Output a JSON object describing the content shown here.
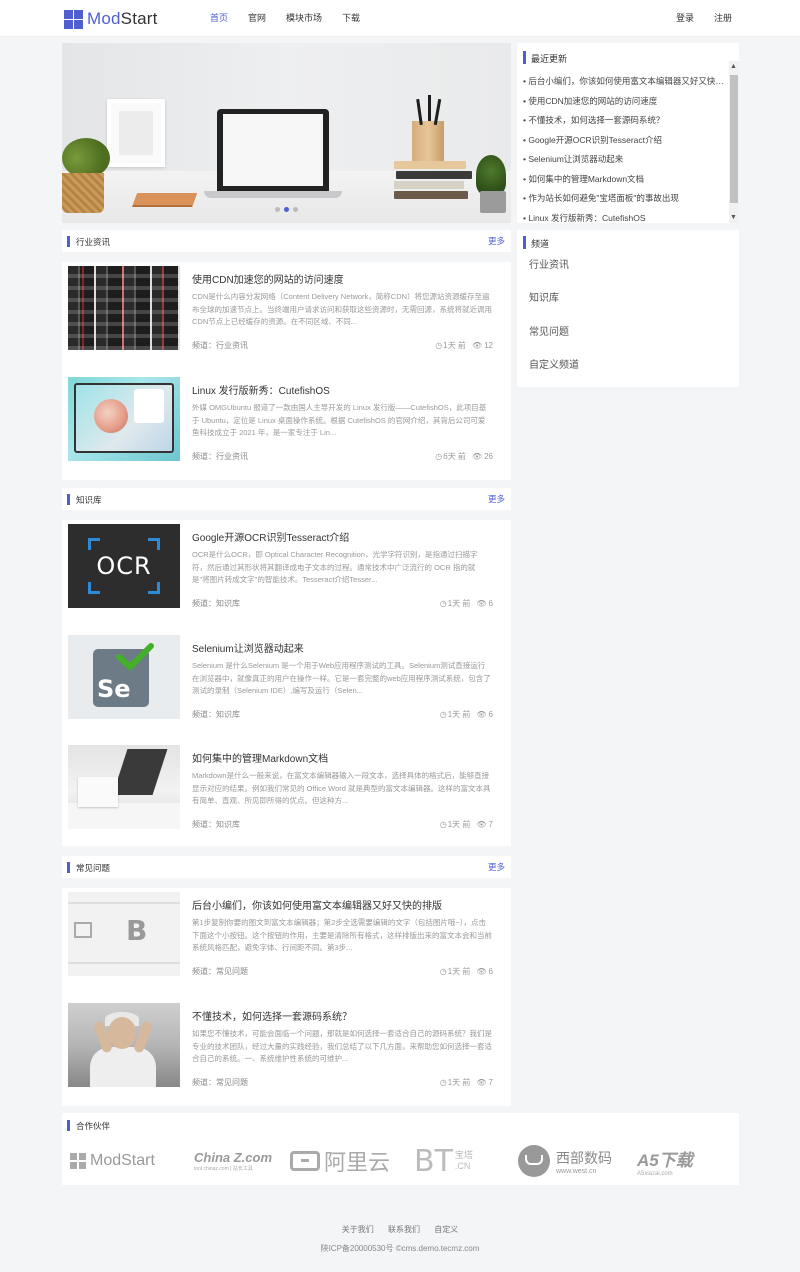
{
  "brand": {
    "logo_a": "Mod",
    "logo_b": "Start"
  },
  "nav": {
    "items": [
      {
        "label": "首页",
        "active": true
      },
      {
        "label": "官网",
        "active": false
      },
      {
        "label": "模块市场",
        "active": false
      },
      {
        "label": "下载",
        "active": false
      }
    ],
    "login": "登录",
    "register": "注册"
  },
  "banner": {
    "slide_index": 2,
    "slide_count": 3
  },
  "latest": {
    "title": "最近更新",
    "items": [
      "后台小编们，你该如何使用富文本编辑器又好又快的排版",
      "使用CDN加速您的网站的访问速度",
      "不懂技术，如何选择一套源码系统？",
      "Google开源OCR识别Tesseract介绍",
      "Selenium让浏览器动起来",
      "如何集中的管理Markdown文档",
      "作为站长如何避免\"宝塔面板\"的事故出现",
      "Linux 发行版新秀：CutefishOS"
    ]
  },
  "channel": {
    "title": "频道",
    "items": [
      "行业资讯",
      "知识库",
      "常见问题",
      "自定义频道"
    ]
  },
  "sections": [
    {
      "title": "行业资讯",
      "more": "更多",
      "articles": [
        {
          "title": "使用CDN加速您的网站的访问速度",
          "desc": "CDN是什么内容分发网络（Content Delivery Network，简称CDN）将您源站资源缓存至遍布全球的加速节点上。当终端用户请求访问和获取这些资源时，无需回源，系统将就近调用CDN节点上已经缓存的资源。在不同区域、不同...",
          "channel": "频道：行业资讯",
          "time": "1天 前",
          "views": "12"
        },
        {
          "title": "Linux 发行版新秀：CutefishOS",
          "desc": "外媒 OMGUbuntu 报道了一款由国人主导开发的 Linux 发行版——CutefishOS，此项目基于 Ubuntu，定位是 Linux 桌面操作系统。根据 CutefishOS 的官网介绍，其背后公司可爱鱼科技成立于 2021 年，是一家专注于 Lin...",
          "channel": "频道：行业资讯",
          "time": "6天 前",
          "views": "26"
        }
      ]
    },
    {
      "title": "知识库",
      "more": "更多",
      "articles": [
        {
          "title": "Google开源OCR识别Tesseract介绍",
          "desc": "OCR是什么OCR，即 Optical Character Recognition，光学字符识别，是指通过扫描字符，然后通过其形状将其翻译成电子文本的过程。通常技术中广泛流行的 OCR 指的就是\"将图片转成文字\"的智能技术。Tesseract介绍Tesser...",
          "channel": "频道：知识库",
          "time": "1天 前",
          "views": "6"
        },
        {
          "title": "Selenium让浏览器动起来",
          "desc": "Selenium 是什么Selenium 是一个用于Web应用程序测试的工具。Selenium测试直接运行在浏览器中，就像真正的用户在操作一样。它是一套完整的web应用程序测试系统，包含了测试的录制（Selenium IDE）,编写及运行（Selen...",
          "channel": "频道：知识库",
          "time": "1天 前",
          "views": "6"
        },
        {
          "title": "如何集中的管理Markdown文档",
          "desc": "Markdown是什么一般来说，在富文本编辑器输入一段文本，选择具体的格式后，能够直接显示对应的结果。例如我们常见的 Office Word 就是典型的富文本编辑器。这样的富文本具有简单、直观、所见即所得的优点。但这种方...",
          "channel": "频道：知识库",
          "time": "1天 前",
          "views": "7"
        }
      ]
    },
    {
      "title": "常见问题",
      "more": "更多",
      "articles": [
        {
          "title": "后台小编们，你该如何使用富文本编辑器又好又快的排版",
          "desc": "第1步复制你要的图文到富文本编辑器；第2步全选需要编辑的文字（包括图片哦~），点击下面这个小按钮。这个按钮的作用，主要是清除所有格式，这样排版出来的富文本会和当前系统风格匹配，避免字体、行间距不同。第3步...",
          "channel": "频道：常见问题",
          "time": "1天 前",
          "views": "6"
        },
        {
          "title": "不懂技术，如何选择一套源码系统？",
          "desc": "如果您不懂技术，可能会面临一个问题，那就是如何选择一套适合自己的源码系统？我们是专业的技术团队，经过大量的实践经验，我们总结了以下几方面，来帮助您如何选择一套适合自己的系统。一、系统维护性系统的可维护...",
          "channel": "频道：常见问题",
          "time": "1天 前",
          "views": "7"
        }
      ]
    }
  ],
  "partners": {
    "title": "合作伙伴",
    "logos": [
      {
        "name": "ModStart",
        "text": "ModStart"
      },
      {
        "name": "China Z",
        "text": "China Z.com",
        "sub": "tool.chinaz.com | 站长工具"
      },
      {
        "name": "阿里云",
        "text": "阿里云"
      },
      {
        "name": "BT宝塔",
        "text": "BT",
        "sub": "宝塔 .CN"
      },
      {
        "name": "西部数码",
        "text": "西部数码",
        "sub": "www.west.cn"
      },
      {
        "name": "A5下载",
        "text": "A5下载",
        "sub": "A5xiazai.com"
      }
    ]
  },
  "footer": {
    "links": [
      "关于我们",
      "联系我们",
      "自定义"
    ],
    "icp": "陕ICP备20000530号 ©cms.demo.tecmz.com"
  },
  "colors": {
    "accent": "#4f5fcf",
    "bg": "#f4f5f7"
  }
}
